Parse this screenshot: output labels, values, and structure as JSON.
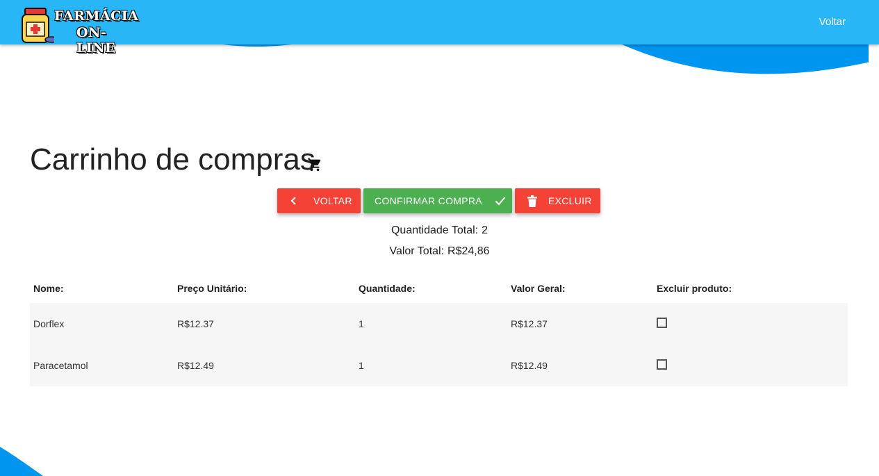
{
  "navbar": {
    "logo_line1": "FARMÁCIA",
    "logo_line2": "ON-LINE",
    "back_link": "Voltar",
    "bg_color": "#29b6f6"
  },
  "page": {
    "title": "Carrinho de compras",
    "cart_icon": "shopping-cart-icon"
  },
  "buttons": {
    "back": "Voltar",
    "confirm": "Confirmar compra",
    "delete": "Excluir",
    "red_color": "#f44336",
    "green_color": "#4caf50"
  },
  "summary": {
    "quantity_label": "Quantidade Total:",
    "quantity_value": "2",
    "total_label": "Valor Total:",
    "total_value": "R$24,86"
  },
  "table": {
    "headers": [
      "Nome:",
      "Preço Unitário:",
      "Quantidade:",
      "Valor Geral:",
      "Excluir produto:"
    ],
    "rows": [
      {
        "name": "Dorflex",
        "unit_price": "R$12.37",
        "quantity": "1",
        "total": "R$12.37",
        "delete_checked": false
      },
      {
        "name": "Paracetamol",
        "unit_price": "R$12.49",
        "quantity": "1",
        "total": "R$12.49",
        "delete_checked": false
      }
    ]
  }
}
